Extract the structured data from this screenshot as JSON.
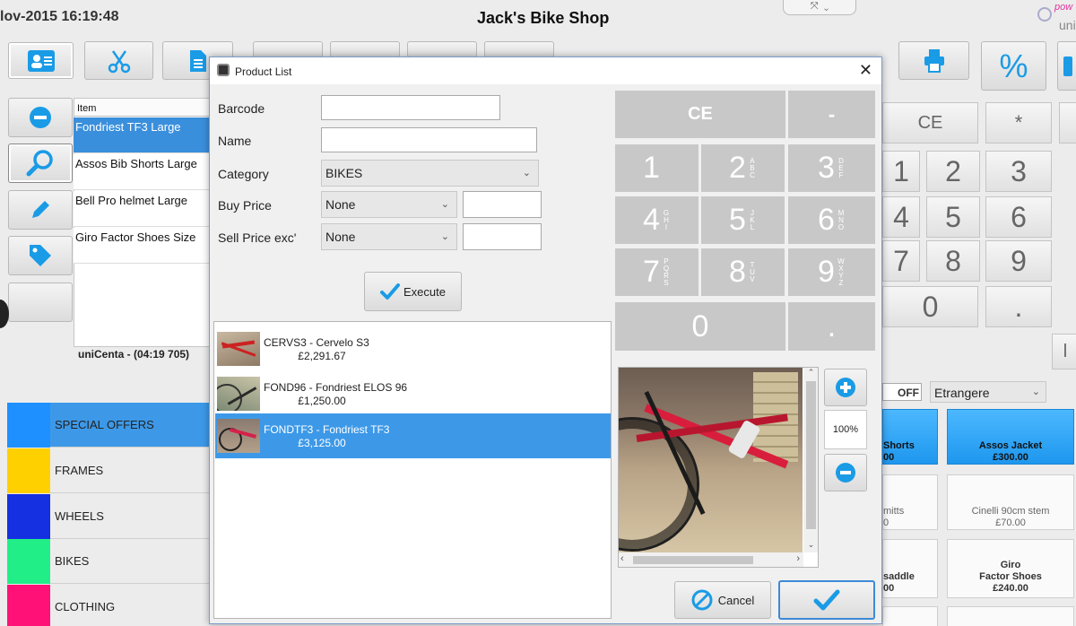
{
  "header": {
    "datetime": "lov-2015 16:19:48",
    "shop_name": "Jack's Bike Shop",
    "logo_text_1": "pow",
    "logo_text_2": "uni"
  },
  "ticket": {
    "column_header": "Item",
    "items": [
      {
        "label": "Fondriest TF3 Large",
        "selected": true
      },
      {
        "label": "Assos Bib Shorts Large",
        "selected": false
      },
      {
        "label": "Bell Pro helmet Large",
        "selected": false
      },
      {
        "label": "Giro Factor Shoes Size",
        "selected": false
      }
    ],
    "footer": "uniCenta - (04:19 705)"
  },
  "categories": [
    {
      "label": "SPECIAL OFFERS",
      "color": "#1e90ff",
      "selected": true
    },
    {
      "label": "FRAMES",
      "color": "#ffd000",
      "selected": false
    },
    {
      "label": "WHEELS",
      "color": "#1530e0",
      "selected": false
    },
    {
      "label": "BIKES",
      "color": "#22ee88",
      "selected": false
    },
    {
      "label": "CLOTHING",
      "color": "#ff1177",
      "selected": false
    }
  ],
  "right_keypad": {
    "ce": "CE",
    "multiply": "*",
    "digits": [
      "1",
      "2",
      "3",
      "4",
      "5",
      "6",
      "7",
      "8",
      "9",
      "0",
      "."
    ]
  },
  "tax_row": {
    "toggle_label": "OFF",
    "select_value": "Etrangere"
  },
  "product_buttons": [
    {
      "line1": "Shorts",
      "line2": "00",
      "highlight": true
    },
    {
      "line1": "Assos Jacket",
      "line2": "£300.00",
      "highlight": true
    },
    {
      "line1": "mitts",
      "line2": "0",
      "highlight": false
    },
    {
      "line1": "Cinelli 90cm stem",
      "line2": "£70.00",
      "highlight": false
    },
    {
      "line1": "saddle",
      "line2": "00",
      "highlight": false
    },
    {
      "line1": "Giro",
      "line1b": "Factor Shoes",
      "line2": "£240.00",
      "highlight": false
    }
  ],
  "dialog": {
    "title": "Product List",
    "fields": {
      "barcode_label": "Barcode",
      "barcode_value": "",
      "name_label": "Name",
      "name_value": "",
      "category_label": "Category",
      "category_value": "BIKES",
      "buy_price_label": "Buy Price",
      "buy_price_op": "None",
      "buy_price_value": "",
      "sell_price_label": "Sell Price exc'",
      "sell_price_op": "None",
      "sell_price_value": ""
    },
    "execute_label": "Execute",
    "keypad": {
      "ce": "CE",
      "minus": "-",
      "keys": [
        {
          "digit": "1",
          "letters": ""
        },
        {
          "digit": "2",
          "letters": "A B C"
        },
        {
          "digit": "3",
          "letters": "D E F"
        },
        {
          "digit": "4",
          "letters": "G H I"
        },
        {
          "digit": "5",
          "letters": "J K L"
        },
        {
          "digit": "6",
          "letters": "M N O"
        },
        {
          "digit": "7",
          "letters": "P Q R S"
        },
        {
          "digit": "8",
          "letters": "T U V"
        },
        {
          "digit": "9",
          "letters": "W X Y Z"
        }
      ],
      "zero": "0",
      "dot": "."
    },
    "results": [
      {
        "code_name": "CERVS3 - Cervelo S3",
        "price": "£2,291.67",
        "selected": false
      },
      {
        "code_name": "FOND96 - Fondriest ELOS 96",
        "price": "£1,250.00",
        "selected": false
      },
      {
        "code_name": "FONDTF3 - Fondriest TF3",
        "price": "£3,125.00",
        "selected": true
      }
    ],
    "zoom": "100%",
    "cancel_label": "Cancel"
  },
  "colors": {
    "accent": "#1e97ee",
    "selection": "#3d99e8",
    "icon_blue": "#1a9be6"
  }
}
